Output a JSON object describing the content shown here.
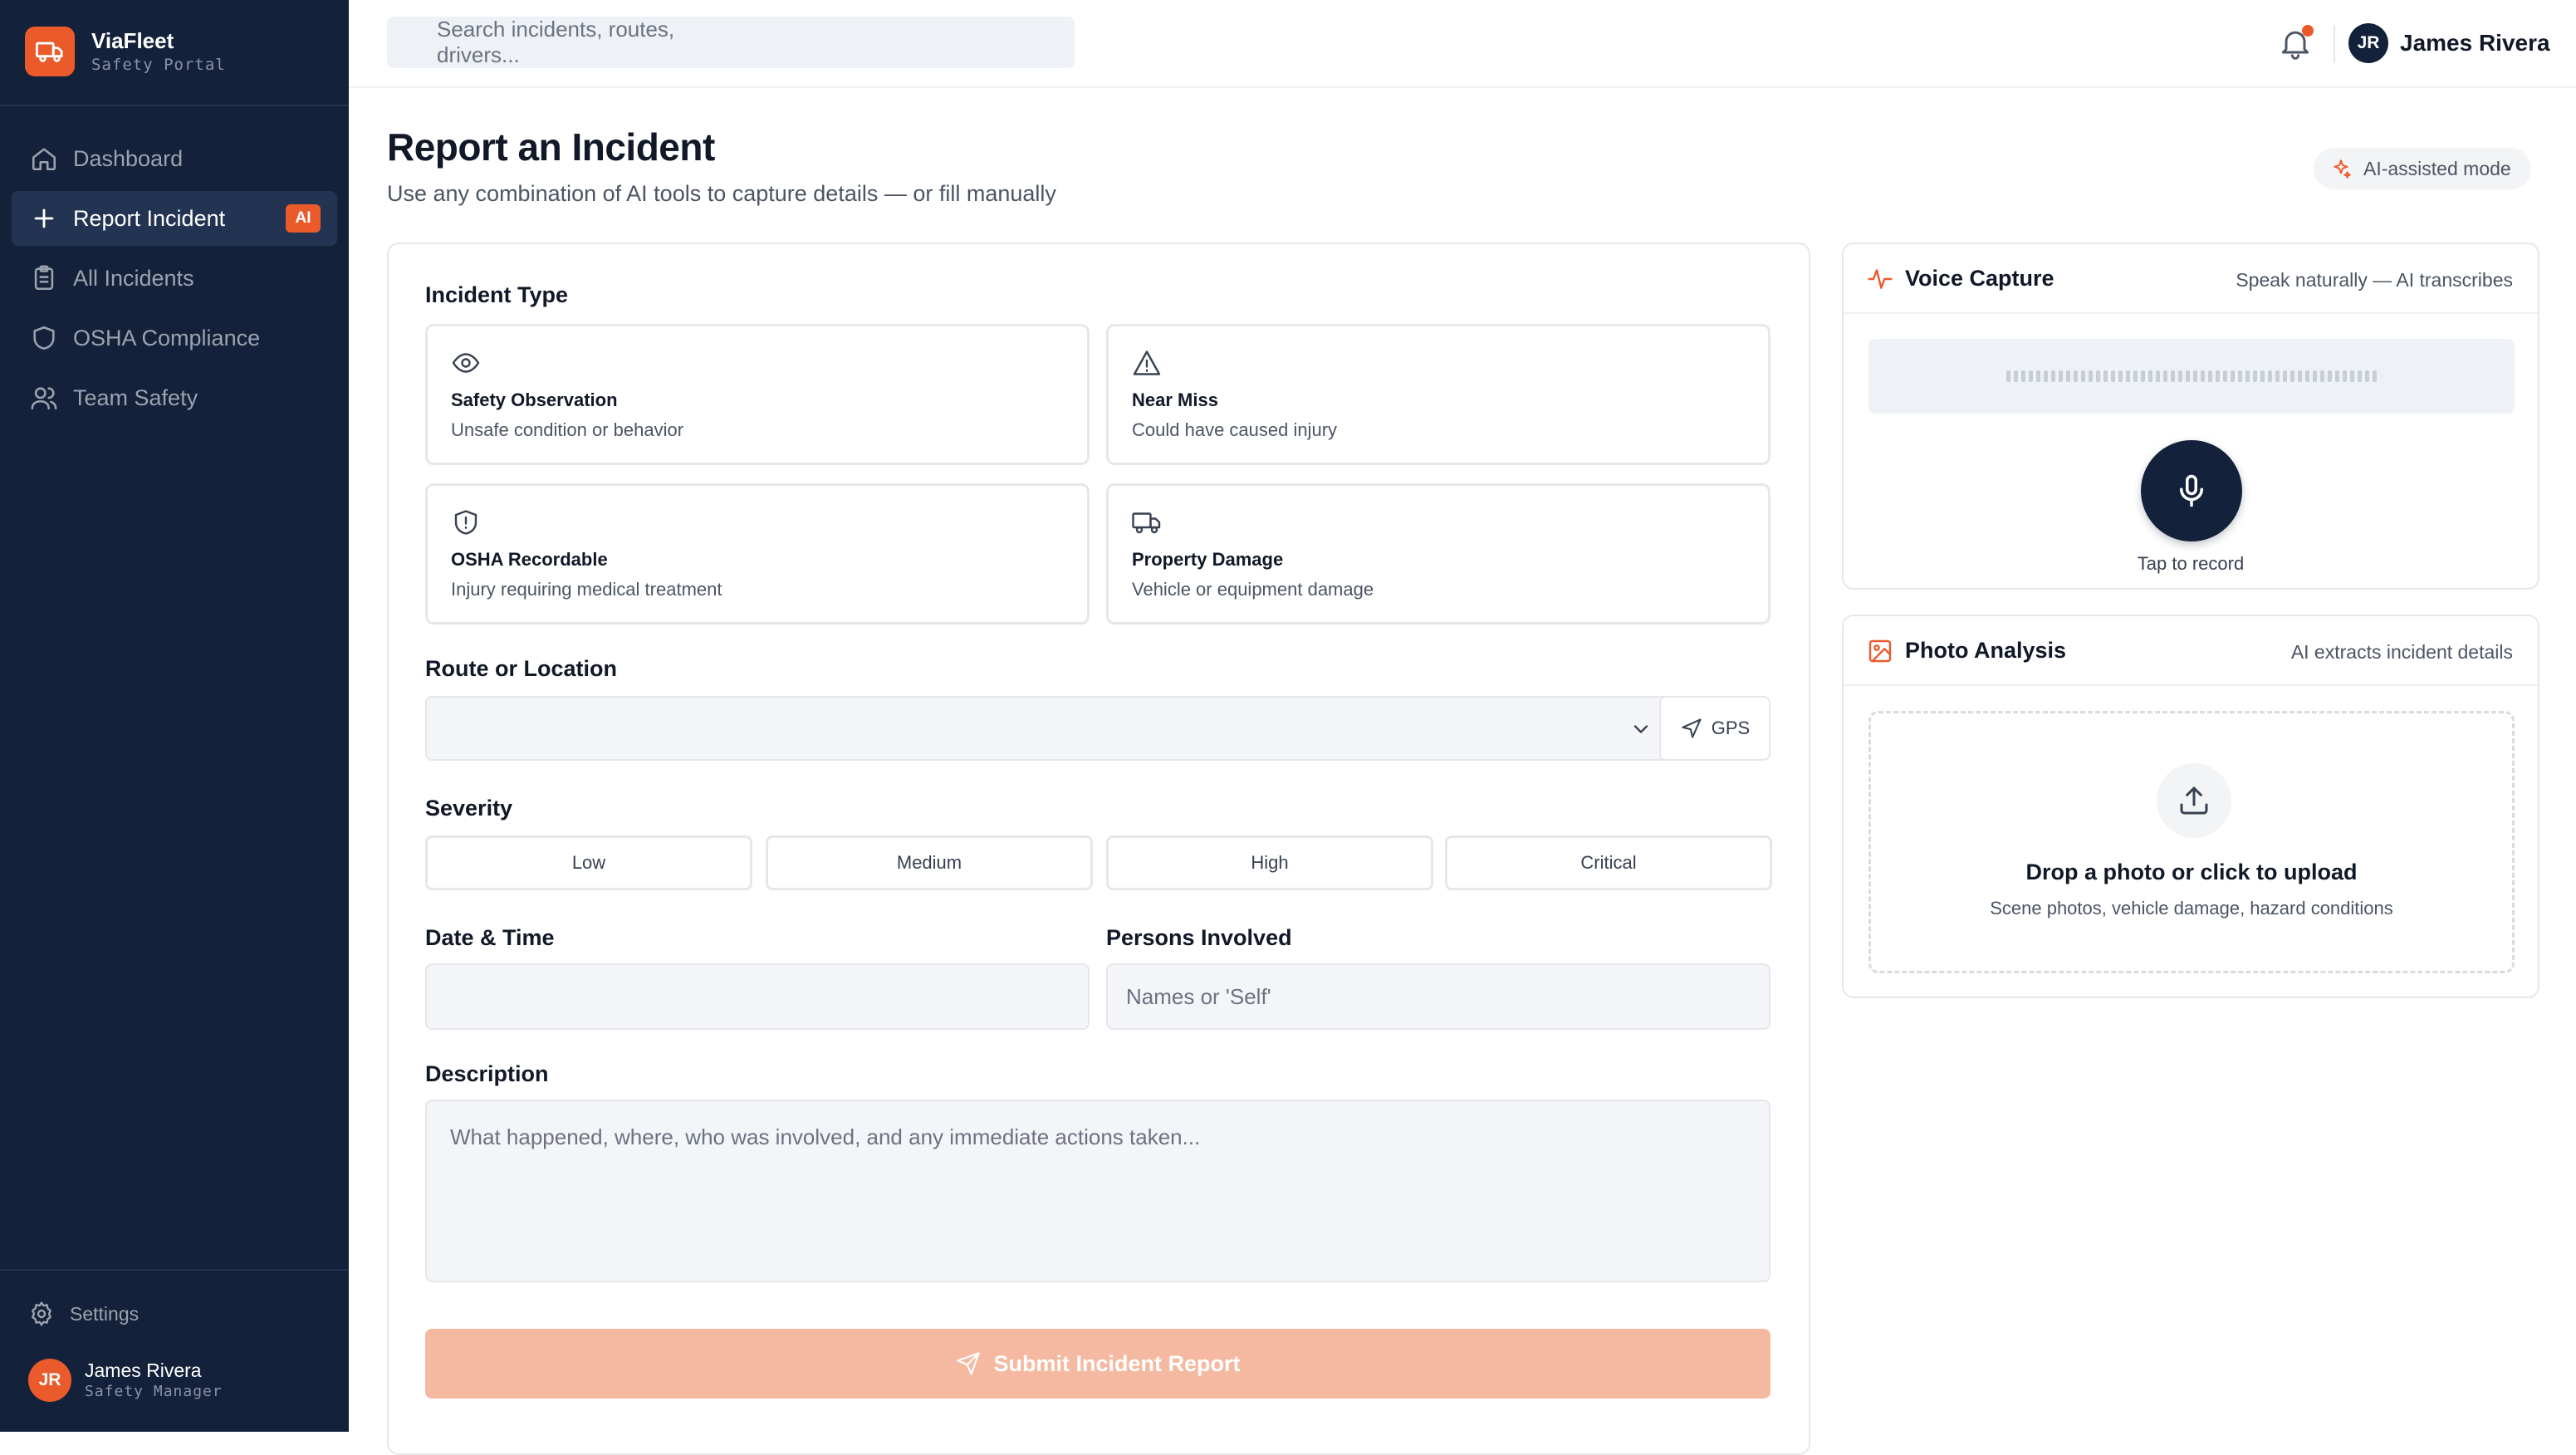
{
  "brand": {
    "name": "ViaFleet",
    "subtitle": "Safety Portal"
  },
  "nav": {
    "items": [
      {
        "label": "Dashboard",
        "icon": "home-icon"
      },
      {
        "label": "Report Incident",
        "icon": "plus-icon",
        "badge": "AI",
        "active": true
      },
      {
        "label": "All Incidents",
        "icon": "clipboard-icon"
      },
      {
        "label": "OSHA Compliance",
        "icon": "shield-icon"
      },
      {
        "label": "Team Safety",
        "icon": "users-icon"
      }
    ],
    "settings_label": "Settings"
  },
  "sidebar_user": {
    "initials": "JR",
    "name": "James Rivera",
    "role": "Safety Manager"
  },
  "topbar": {
    "search_placeholder": "Search incidents, routes, drivers...",
    "user_initials": "JR",
    "user_name": "James Rivera"
  },
  "page": {
    "title": "Report an Incident",
    "subtitle": "Use any combination of AI tools to capture details — or fill manually",
    "ai_mode_label": "AI-assisted mode"
  },
  "form": {
    "incident_type_label": "Incident Type",
    "types": [
      {
        "title": "Safety Observation",
        "desc": "Unsafe condition or behavior",
        "icon": "eye-icon"
      },
      {
        "title": "Near Miss",
        "desc": "Could have caused injury",
        "icon": "warning-icon"
      },
      {
        "title": "OSHA Recordable",
        "desc": "Injury requiring medical treatment",
        "icon": "shield-alert-icon"
      },
      {
        "title": "Property Damage",
        "desc": "Vehicle or equipment damage",
        "icon": "truck-icon"
      }
    ],
    "route_label": "Route or Location",
    "gps_label": "GPS",
    "severity_label": "Severity",
    "severity_options": [
      "Low",
      "Medium",
      "High",
      "Critical"
    ],
    "datetime_label": "Date & Time",
    "persons_label": "Persons Involved",
    "persons_placeholder": "Names or 'Self'",
    "description_label": "Description",
    "description_placeholder": "What happened, where, who was involved, and any immediate actions taken...",
    "submit_label": "Submit Incident Report"
  },
  "voice": {
    "title": "Voice Capture",
    "hint": "Speak naturally — AI transcribes",
    "record_label": "Tap to record"
  },
  "photo": {
    "title": "Photo Analysis",
    "hint": "AI extracts incident details",
    "drop_title": "Drop a photo or click to upload",
    "drop_sub": "Scene photos, vehicle damage, hazard conditions"
  },
  "colors": {
    "accent": "#ea5a2a",
    "sidebar": "#14213a",
    "submit_disabled": "#f5b9a1"
  }
}
